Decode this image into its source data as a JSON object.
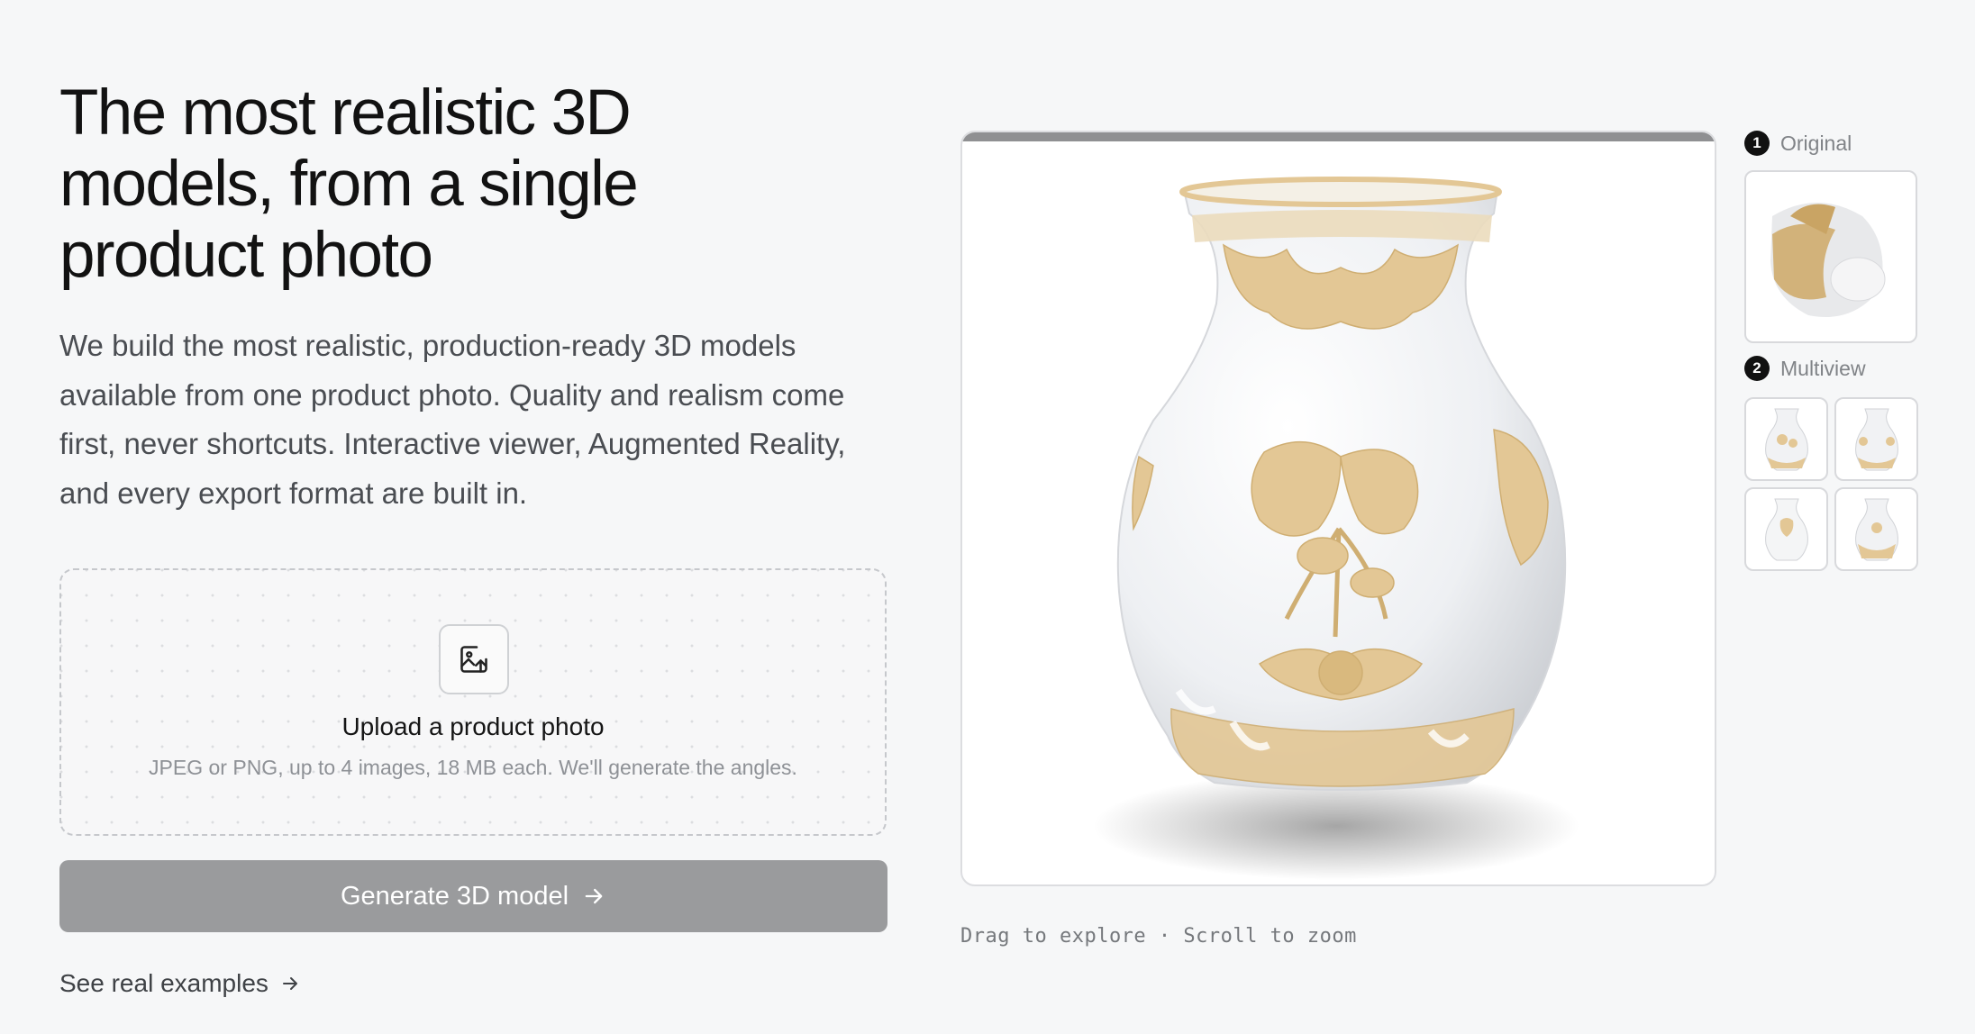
{
  "hero": {
    "title_line1": "The most realistic 3D",
    "title_line2": "models, from a single",
    "title_line3": "product photo",
    "description": "We build the most realistic, production-ready 3D models available from one product photo. Quality and realism come first, never shortcuts. Interactive viewer, Augmented Reality, and every export format are built in."
  },
  "upload": {
    "icon": "image-upload-icon",
    "title": "Upload a product photo",
    "subtitle": "JPEG or PNG, up to 4 images, 18 MB each. We'll generate the angles."
  },
  "actions": {
    "generate_label": "Generate 3D model",
    "examples_label": "See real examples"
  },
  "viewer": {
    "hint": "Drag to explore · Scroll to zoom"
  },
  "steps": [
    {
      "number": "1",
      "label": "Original"
    },
    {
      "number": "2",
      "label": "Multiview"
    }
  ],
  "colors": {
    "background": "#f6f7f8",
    "button_disabled": "#9a9b9d",
    "vase_gold": "#e3c795"
  }
}
